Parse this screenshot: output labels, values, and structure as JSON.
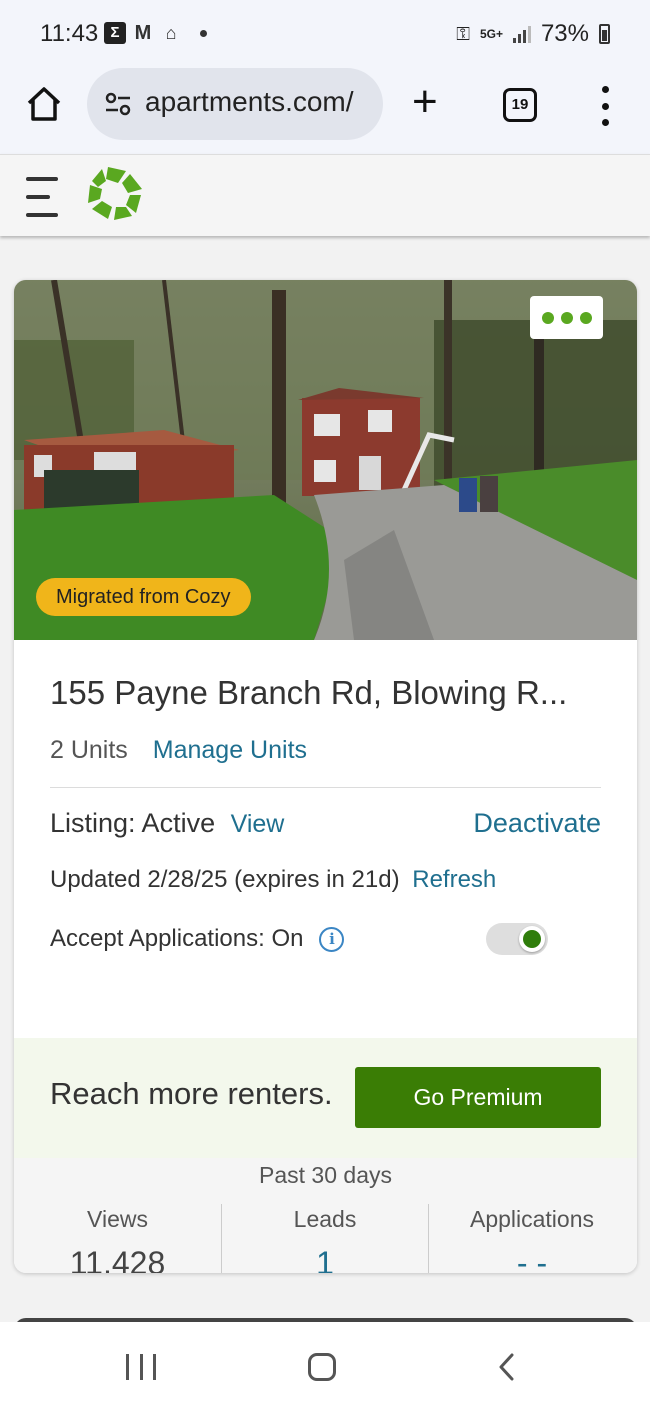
{
  "status_bar": {
    "time": "11:43",
    "network": "5G+",
    "battery": "73%"
  },
  "browser": {
    "url": "apartments.com/",
    "tab_count": "19"
  },
  "listing": {
    "badge": "Migrated from Cozy",
    "address": "155 Payne Branch Rd, Blowing R...",
    "units_count": "2 Units",
    "manage_units_label": "Manage Units",
    "listing_status": "Listing: Active",
    "view_label": "View",
    "deactivate_label": "Deactivate",
    "updated_text": "Updated 2/28/25 (expires in 21d)",
    "refresh_label": "Refresh",
    "accept_applications": "Accept Applications: On",
    "accept_applications_on": true
  },
  "premium": {
    "text": "Reach more renters.",
    "button_label": "Go Premium"
  },
  "stats": {
    "title": "Past 30 days",
    "columns": [
      {
        "label": "Views",
        "value": "11,428"
      },
      {
        "label": "Leads",
        "value": "1"
      },
      {
        "label": "Applications",
        "value": "- -"
      }
    ]
  },
  "colors": {
    "brand_green": "#5aa820",
    "button_green": "#3a7d05",
    "link_blue": "#1f6f8f",
    "badge_yellow": "#f0b51a"
  }
}
